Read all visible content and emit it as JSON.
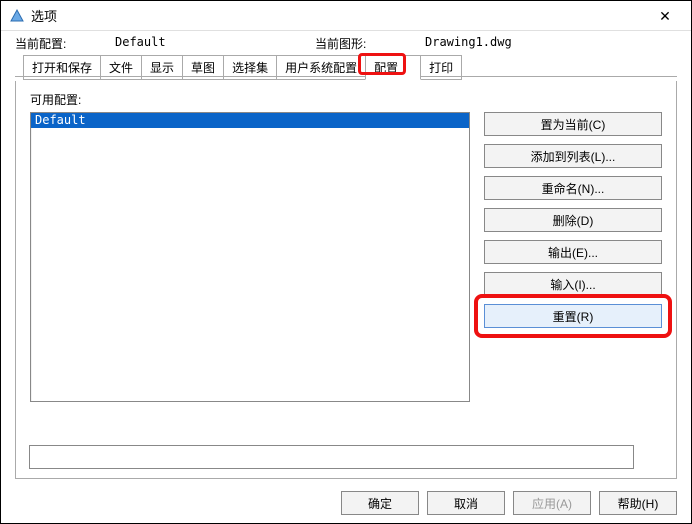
{
  "window": {
    "title": "选项",
    "close": "✕"
  },
  "info": {
    "current_profile_label": "当前配置:",
    "current_profile_value": "Default",
    "current_drawing_label": "当前图形:",
    "current_drawing_value": "Drawing1.dwg"
  },
  "tabs": {
    "t0": "打开和保存",
    "t1": "文件",
    "t2": "显示",
    "t3": "草图",
    "t4": "选择集",
    "t5": "用户系统配置",
    "t6": "配置",
    "t7": "打印"
  },
  "section": {
    "available_label": "可用配置:"
  },
  "list": {
    "item0": "Default"
  },
  "buttons": {
    "set_current": "置为当前(C)",
    "add_to_list": "添加到列表(L)...",
    "rename": "重命名(N)...",
    "delete": "删除(D)",
    "export": "输出(E)...",
    "import": "输入(I)...",
    "reset": "重置(R)"
  },
  "footer": {
    "ok": "确定",
    "cancel": "取消",
    "apply": "应用(A)",
    "help": "帮助(H)"
  }
}
